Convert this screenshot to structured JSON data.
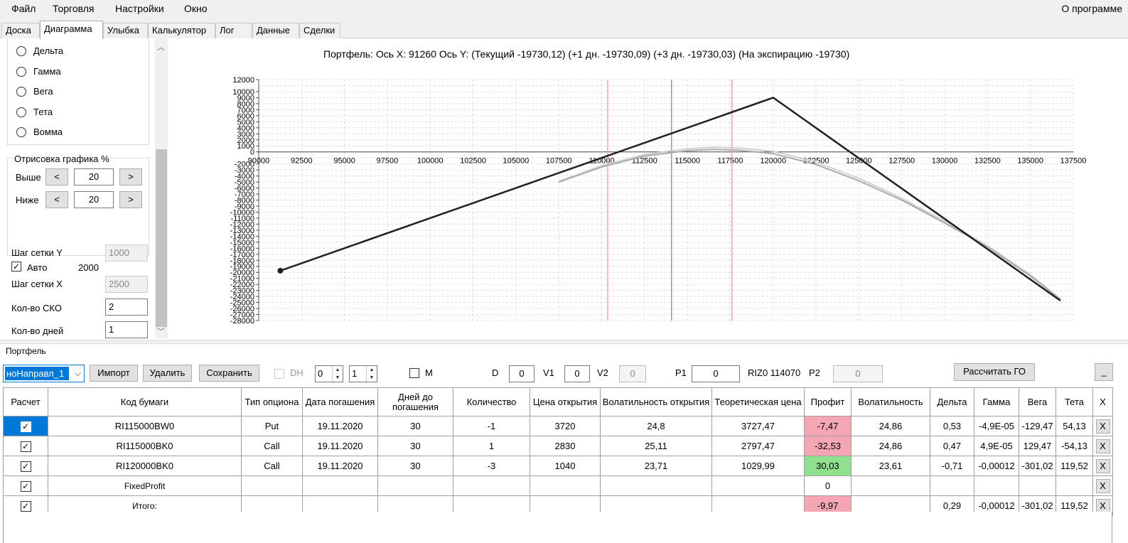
{
  "menu": {
    "items": [
      "Файл",
      "Торговля",
      "Настройки",
      "Окно"
    ],
    "about": "О программе"
  },
  "tabs": [
    "Доска",
    "Диаграмма",
    "Улыбка",
    "Калькулятор",
    "Лог",
    "Данные",
    "Сделки"
  ],
  "active_tab": "Диаграмма",
  "left_panel": {
    "radios": [
      "Дельта",
      "Гамма",
      "Вега",
      "Тета",
      "Вомма"
    ],
    "draw_group_title": "Отрисовка графика %",
    "above_label": "Выше",
    "below_label": "Ниже",
    "above_value": "20",
    "below_value": "20",
    "dec_label": "<",
    "inc_label": ">",
    "grid_step_y_label": "Шаг сетки Y",
    "grid_step_y_value": "1000",
    "auto_label": "Авто",
    "auto_checked": true,
    "auto_value": "2000",
    "grid_step_x_label": "Шаг сетки X",
    "grid_step_x_value": "2500",
    "sko_label": "Кол-во СКО",
    "sko_value": "2",
    "days_label": "Кол-во дней",
    "days_value": "1"
  },
  "chart_title": "Портфель:  Ось X:  91260  Ось Y:   (Текущий -19730,12)   (+1 дн.  -19730,09)   (+3 дн.  -19730,03)   (На экспирацию -19730)",
  "chart_data": {
    "type": "line",
    "xlim": [
      90000,
      137500
    ],
    "ylim": [
      -28000,
      12000
    ],
    "x_ticks": [
      90000,
      92500,
      95000,
      97500,
      100000,
      102500,
      105000,
      107500,
      110000,
      112500,
      115000,
      117500,
      120000,
      122500,
      125000,
      127500,
      130000,
      132500,
      135000,
      137500
    ],
    "y_ticks": [
      12000,
      10000,
      9000,
      8000,
      7000,
      6000,
      5000,
      4000,
      3000,
      2000,
      1000,
      0,
      -2000,
      -3000,
      -4000,
      -5000,
      -6000,
      -7000,
      -8000,
      -9000,
      -10000,
      -11000,
      -12000,
      -13000,
      -14000,
      -15000,
      -16000,
      -17000,
      -18000,
      -19000,
      -20000,
      -21000,
      -22000,
      -23000,
      -24000,
      -25000,
      -26000,
      -27000,
      -28000
    ],
    "grid": true,
    "vertical_lines": [
      {
        "x": 110350,
        "color": "#f4a0a8"
      },
      {
        "x": 114070,
        "color": "#8899bb"
      },
      {
        "x": 117600,
        "color": "#f4a0a8"
      }
    ],
    "series": [
      {
        "color": "#202020",
        "x": [
          91260,
          120000,
          136750
        ],
        "y": [
          -19730,
          9000,
          -24700
        ]
      },
      {
        "color": "#aaaaaa",
        "x": [
          107500,
          110000,
          112500,
          114000,
          115000,
          116500,
          118000,
          120000,
          122500,
          125000,
          127500,
          130000,
          132500,
          135000,
          136750
        ],
        "y": [
          -5000,
          -2500,
          -700,
          -150,
          200,
          400,
          300,
          -300,
          -2100,
          -4800,
          -8000,
          -11800,
          -15800,
          -20600,
          -24500
        ]
      },
      {
        "color": "#cfcfcf",
        "x": [
          107500,
          110000,
          112500,
          114000,
          115000,
          116500,
          118000,
          120000,
          122500,
          125000,
          127500,
          130000,
          132500,
          135000,
          136750
        ],
        "y": [
          -4900,
          -2300,
          -450,
          150,
          500,
          750,
          650,
          100,
          -1700,
          -4400,
          -7700,
          -11500,
          -15600,
          -20400,
          -24400
        ]
      }
    ],
    "marker": {
      "x": 91260,
      "y": -19730
    }
  },
  "portfolio": {
    "label": "Портфель",
    "combo_value": "ноНаправл_1",
    "import_label": "Импорт",
    "delete_label": "Удалить",
    "save_label": "Сохранить",
    "dh_label": "DH",
    "spin1": "0",
    "spin2": "1",
    "m_label": "M",
    "d_label": "D",
    "d_value": "0",
    "v1_label": "V1",
    "v1_value": "0",
    "v2_label": "V2",
    "v2_value": "0",
    "p1_label": "P1",
    "p1_value": "0",
    "riz_label": "RIZ0 114070",
    "p2_label": "P2",
    "p2_value": "0",
    "calc_go_label": "Рассчитать ГО",
    "minimize_label": "_"
  },
  "grid": {
    "columns": [
      "Расчет",
      "Код бумаги",
      "Тип опциона",
      "Дата погашения",
      "Дней до погашения",
      "Количество",
      "Цена открытия",
      "Волатильность открытия",
      "Теоретическая цена",
      "Профит",
      "Волатильность",
      "Дельта",
      "Гамма",
      "Вега",
      "Тета",
      "X"
    ],
    "rows": [
      {
        "code": "RI115000BW0",
        "type": "Put",
        "date": "19.11.2020",
        "days": "30",
        "qty": "-1",
        "price": "3720",
        "vol_open": "24,8",
        "theo": "3727,47",
        "profit": "-7,47",
        "profit_state": "neg",
        "vol": "24,86",
        "delta": "0,53",
        "gamma": "-4,9E-05",
        "vega": "-129,47",
        "theta": "54,13",
        "x": "X"
      },
      {
        "code": "RI115000BK0",
        "type": "Call",
        "date": "19.11.2020",
        "days": "30",
        "qty": "1",
        "price": "2830",
        "vol_open": "25,11",
        "theo": "2797,47",
        "profit": "-32,53",
        "profit_state": "neg",
        "vol": "24,86",
        "delta": "0,47",
        "gamma": "4,9E-05",
        "vega": "129,47",
        "theta": "-54,13",
        "x": "X"
      },
      {
        "code": "RI120000BK0",
        "type": "Call",
        "date": "19.11.2020",
        "days": "30",
        "qty": "-3",
        "price": "1040",
        "vol_open": "23,71",
        "theo": "1029,99",
        "profit": "30,03",
        "profit_state": "pos",
        "vol": "23,61",
        "delta": "-0,71",
        "gamma": "-0,00012",
        "vega": "-301,02",
        "theta": "119,52",
        "x": "X"
      },
      {
        "code": "FixedProfit",
        "type": "",
        "date": "",
        "days": "",
        "qty": "",
        "price": "",
        "vol_open": "",
        "theo": "",
        "profit": "0",
        "profit_state": "",
        "vol": "",
        "delta": "",
        "gamma": "",
        "vega": "",
        "theta": "",
        "x": "X"
      },
      {
        "code": "Итого:",
        "type": "",
        "date": "",
        "days": "",
        "qty": "",
        "price": "",
        "vol_open": "",
        "theo": "",
        "profit": "-9,97",
        "profit_state": "neg",
        "vol": "",
        "delta": "0,29",
        "gamma": "-0,00012",
        "vega": "-301,02",
        "theta": "119,52",
        "x": "X"
      }
    ]
  }
}
